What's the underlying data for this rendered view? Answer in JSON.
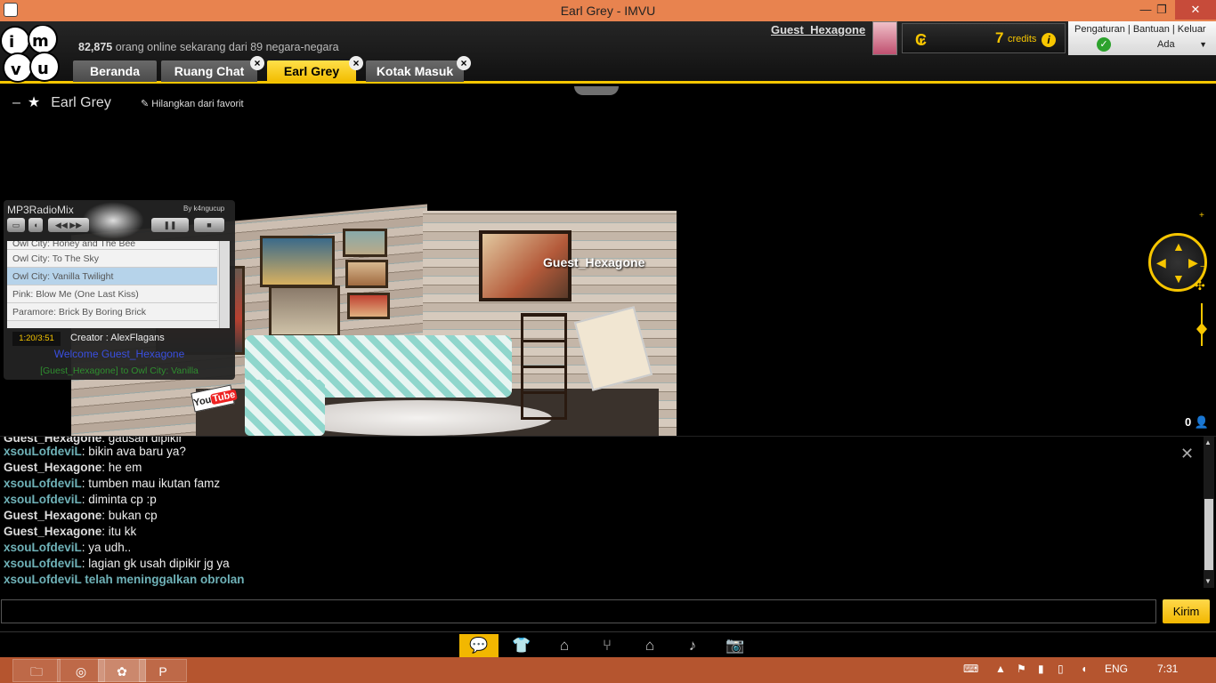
{
  "window": {
    "title": "Earl Grey  - IMVU",
    "minimize": "—",
    "maximize": "❐",
    "close": "✕"
  },
  "header": {
    "online_count": "82,875",
    "online_text": " orang online sekarang dari 89 negara-negara",
    "username": "Guest_Hexagone",
    "credits_value": "7",
    "credits_label": "credits",
    "credits_info": "i",
    "settings_links": "Pengaturan  |  Bantuan  |  Keluar",
    "status": "Ada"
  },
  "tabs": [
    {
      "label": "Beranda"
    },
    {
      "label": "Ruang Chat",
      "close": "×"
    },
    {
      "label": "Earl Grey",
      "close": "×"
    },
    {
      "label": "Kotak Masuk",
      "close": "×"
    }
  ],
  "room": {
    "name": "Earl Grey",
    "minus": "–",
    "fav_link": "Hilangkan dari favorit",
    "avatar_name": "Guest_Hexagone",
    "user_count": "0"
  },
  "radio": {
    "title": "MP3RadioMix",
    "by": "By k4ngucup",
    "playlist": [
      "Owl City: Honey and The Bee",
      "Owl City: To The Sky",
      "Owl City: Vanilla Twilight",
      "Pink: Blow Me (One Last Kiss)",
      "Paramore: Brick By Boring Brick"
    ],
    "selected_index": 2,
    "time": "1:20/3:51",
    "creator": "Creator : AlexFlagans",
    "welcome": "Welcome Guest_Hexagone",
    "request": "[Guest_Hexagone] to Owl City: Vanilla"
  },
  "chat": {
    "lines": [
      {
        "user": "Guest_Hexagone",
        "kind": "guest",
        "text": ": gausah dipikir"
      },
      {
        "user": "xsouLofdeviL",
        "kind": "xsou",
        "text": ": bikin ava baru ya?"
      },
      {
        "user": "Guest_Hexagone",
        "kind": "guest",
        "text": ": he em"
      },
      {
        "user": "xsouLofdeviL",
        "kind": "xsou",
        "text": ": tumben mau ikutan famz"
      },
      {
        "user": "xsouLofdeviL",
        "kind": "xsou",
        "text": ": diminta cp :p"
      },
      {
        "user": "Guest_Hexagone",
        "kind": "guest",
        "text": ": bukan cp"
      },
      {
        "user": "Guest_Hexagone",
        "kind": "guest",
        "text": ": itu kk"
      },
      {
        "user": "xsouLofdeviL",
        "kind": "xsou",
        "text": ": ya udh.."
      },
      {
        "user": "xsouLofdeviL",
        "kind": "xsou",
        "text": ": lagian gk usah dipikir jg ya"
      }
    ],
    "leave_note": "xsouLofdeviL telah meninggalkan obrolan",
    "send_label": "Kirim",
    "input_value": ""
  },
  "dock": [
    "chat-icon",
    "shirt-icon",
    "hanger-icon",
    "pose-icon",
    "home-icon",
    "music-icon",
    "camera-icon"
  ],
  "taskbar": {
    "lang": "ENG",
    "clock": "7:31"
  },
  "colors": {
    "accent": "#f7c600",
    "title_bar": "#e8834f",
    "taskbar": "#b5552f",
    "chat_user_other": "#6fb2b8"
  }
}
